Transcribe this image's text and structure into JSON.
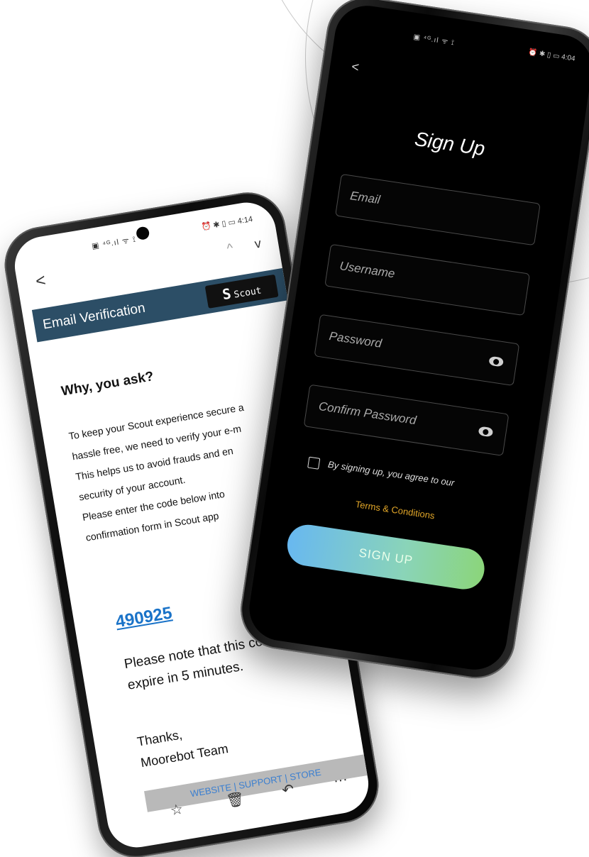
{
  "left_phone": {
    "status": {
      "left": "▣ ⁴ᴳ.ıl ᯤ ⟟",
      "right": "⏰ ✱ ▯ ▭ 4:14"
    },
    "nav": {
      "back": "<",
      "up": "^",
      "down": "v"
    },
    "header": {
      "title": "Email Verification",
      "logo_mark": "S",
      "logo_text": "Scout"
    },
    "heading": "Why, you ask?",
    "body_lines": [
      "To keep your Scout experience secure a",
      "hassle free, we need to verify your e-m",
      "This helps us to avoid frauds and en",
      "security of your account.",
      "Please enter the code below into",
      "confirmation form in Scout app"
    ],
    "code": "490925",
    "note_lines": [
      "Please note that this code",
      "expire in 5 minutes."
    ],
    "sign_lines": [
      "Thanks,",
      "Moorebot Team"
    ],
    "footer": "WEBSITE | SUPPORT | STORE",
    "bottom_icons": {
      "star": "☆",
      "trash": "🗑",
      "reply": "↶",
      "more": "..."
    }
  },
  "right_phone": {
    "status": {
      "left": "▣ ⁴ᴳ.ıl ᯤ ⟟",
      "right": "⏰ ✱ ▯ ▭ 4:04"
    },
    "back": "<",
    "title": "Sign Up",
    "fields": {
      "email": "Email",
      "username": "Username",
      "password": "Password",
      "confirm_password": "Confirm Password"
    },
    "agree_text": "By signing up, you agree to our",
    "terms": "Terms & Conditions",
    "signup_button": "SIGN UP"
  },
  "colors": {
    "header_band": "#2c4e66",
    "code_link": "#1a73c8",
    "terms": "#e0a528",
    "button_start": "#68b8f0",
    "button_end": "#8bd57a"
  }
}
